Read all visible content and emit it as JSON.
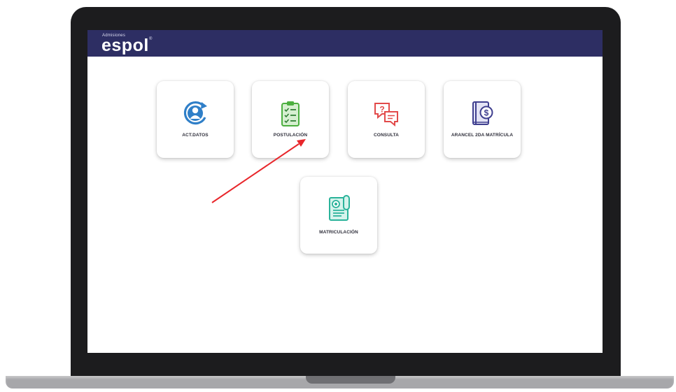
{
  "header": {
    "brand_small": "Admisiones",
    "brand_name": "espol",
    "brand_reg": "®"
  },
  "tiles": [
    {
      "label": "ACT.DATOS",
      "icon": "user-refresh-icon"
    },
    {
      "label": "POSTULACIÓN",
      "icon": "clipboard-checklist-icon"
    },
    {
      "label": "CONSULTA",
      "icon": "chat-question-icon"
    },
    {
      "label": "ARANCEL 2DA MATRÍCULA",
      "icon": "book-dollar-icon"
    },
    {
      "label": "MATRICULACIÓN",
      "icon": "certificate-icon"
    }
  ],
  "annotation": {
    "icon": "red-arrow-icon",
    "points_to": "POSTULACIÓN",
    "color": "#e8262b"
  },
  "colors": {
    "header": "#2d2e63",
    "accent_blue": "#2f7fc8",
    "accent_green": "#4caf3f",
    "accent_red": "#e24a4a",
    "accent_purple": "#3f3f8f",
    "accent_teal": "#2ab39a"
  }
}
